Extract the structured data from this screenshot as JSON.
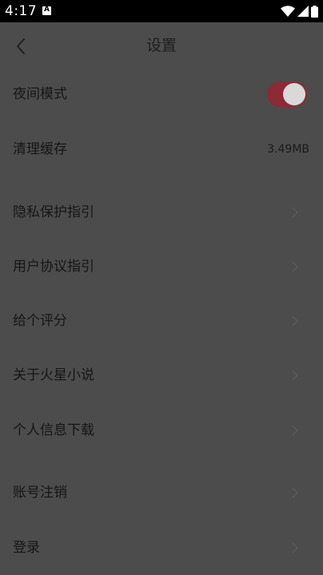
{
  "status_bar": {
    "time": "4:17",
    "icons": [
      "notification-a-icon",
      "wifi-icon",
      "signal-icon",
      "battery-icon"
    ]
  },
  "header": {
    "title": "设置",
    "back_icon": "chevron-left-icon"
  },
  "settings": {
    "night_mode": {
      "label": "夜间模式",
      "enabled": true
    },
    "clear_cache": {
      "label": "清理缓存",
      "value": "3.49MB"
    },
    "privacy_guide": {
      "label": "隐私保护指引"
    },
    "user_agreement": {
      "label": "用户协议指引"
    },
    "rate": {
      "label": "给个评分"
    },
    "about": {
      "label": "关于火星小说"
    },
    "personal_info_download": {
      "label": "个人信息下载"
    },
    "account_cancel": {
      "label": "账号注销"
    },
    "login": {
      "label": "登录"
    }
  },
  "colors": {
    "overlay_background": "#4c4c4c",
    "toggle_track": "#8c2a36",
    "text": "#161616"
  }
}
